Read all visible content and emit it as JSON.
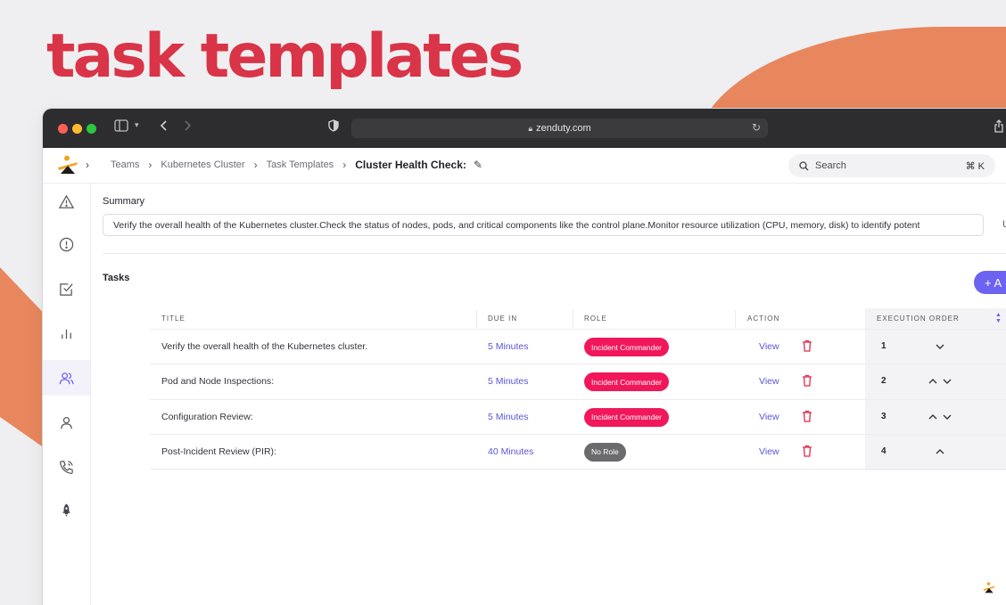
{
  "hero": {
    "title": "task templates"
  },
  "browser": {
    "url": "zenduty.com"
  },
  "breadcrumb": {
    "items": [
      "Teams",
      "Kubernetes Cluster",
      "Task Templates"
    ],
    "current": "Cluster Health Check:"
  },
  "search": {
    "label": "Search",
    "shortcut": "⌘ K"
  },
  "summary": {
    "label": "Summary",
    "value": "Verify the overall health of the Kubernetes cluster.Check the status of nodes, pods, and critical components like the control plane.Monitor resource utilization (CPU, memory, disk) to identify potent",
    "extra": "U"
  },
  "tasks": {
    "label": "Tasks",
    "add_label": "+ A",
    "columns": [
      "TITLE",
      "DUE IN",
      "ROLE",
      "ACTION",
      "EXECUTION ORDER"
    ],
    "rows": [
      {
        "title": "Verify the overall health of the Kubernetes cluster.",
        "due": "5 Minutes",
        "role": "Incident Commander",
        "role_color": "#f0185a",
        "action": "View",
        "order": "1",
        "up": false,
        "down": true
      },
      {
        "title": "Pod and Node Inspections:",
        "due": "5 Minutes",
        "role": "Incident Commander",
        "role_color": "#f0185a",
        "action": "View",
        "order": "2",
        "up": true,
        "down": true
      },
      {
        "title": "Configuration Review:",
        "due": "5 Minutes",
        "role": "Incident Commander",
        "role_color": "#f0185a",
        "action": "View",
        "order": "3",
        "up": true,
        "down": true
      },
      {
        "title": "Post-Incident Review (PIR):",
        "due": "40 Minutes",
        "role": "No Role",
        "role_color": "#6b6b6e",
        "action": "View",
        "order": "4",
        "up": true,
        "down": false
      }
    ]
  },
  "colors": {
    "accent": "#6c63f0",
    "brand_red": "#d93447",
    "deco_orange": "#e8875d"
  }
}
